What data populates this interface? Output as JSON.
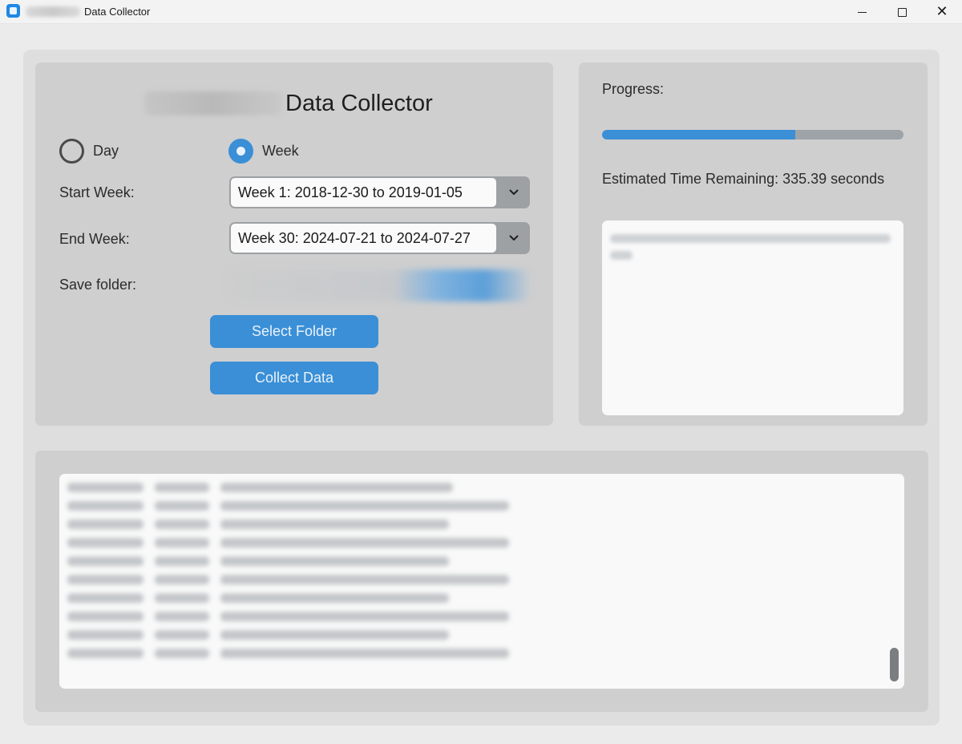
{
  "window": {
    "title": "Data Collector",
    "icon": "app-window-icon",
    "controls": {
      "minimize": "minimize-icon",
      "maximize": "maximize-icon",
      "close": "close-icon",
      "close_glyph": "✕"
    }
  },
  "form": {
    "heading": "Data Collector",
    "mode_options": [
      {
        "label": "Day",
        "selected": false
      },
      {
        "label": "Week",
        "selected": true
      }
    ],
    "start_week": {
      "label": "Start Week:",
      "value": "Week 1: 2018-12-30 to 2019-01-05",
      "icon": "chevron-down-icon"
    },
    "end_week": {
      "label": "End Week:",
      "value": "Week 30: 2024-07-21 to 2024-07-27",
      "icon": "chevron-down-icon"
    },
    "save_folder": {
      "label": "Save folder:"
    },
    "select_folder_button": "Select Folder",
    "collect_data_button": "Collect Data"
  },
  "progress": {
    "label": "Progress:",
    "fraction": 0.64,
    "eta_text": "Estimated Time Remaining: 335.39 seconds"
  },
  "colors": {
    "accent": "#3a8fd6",
    "panel": "#cfcfcf",
    "frame": "#dedede",
    "window_bg": "#ebebeb",
    "progress_track": "#9ea3a8"
  }
}
